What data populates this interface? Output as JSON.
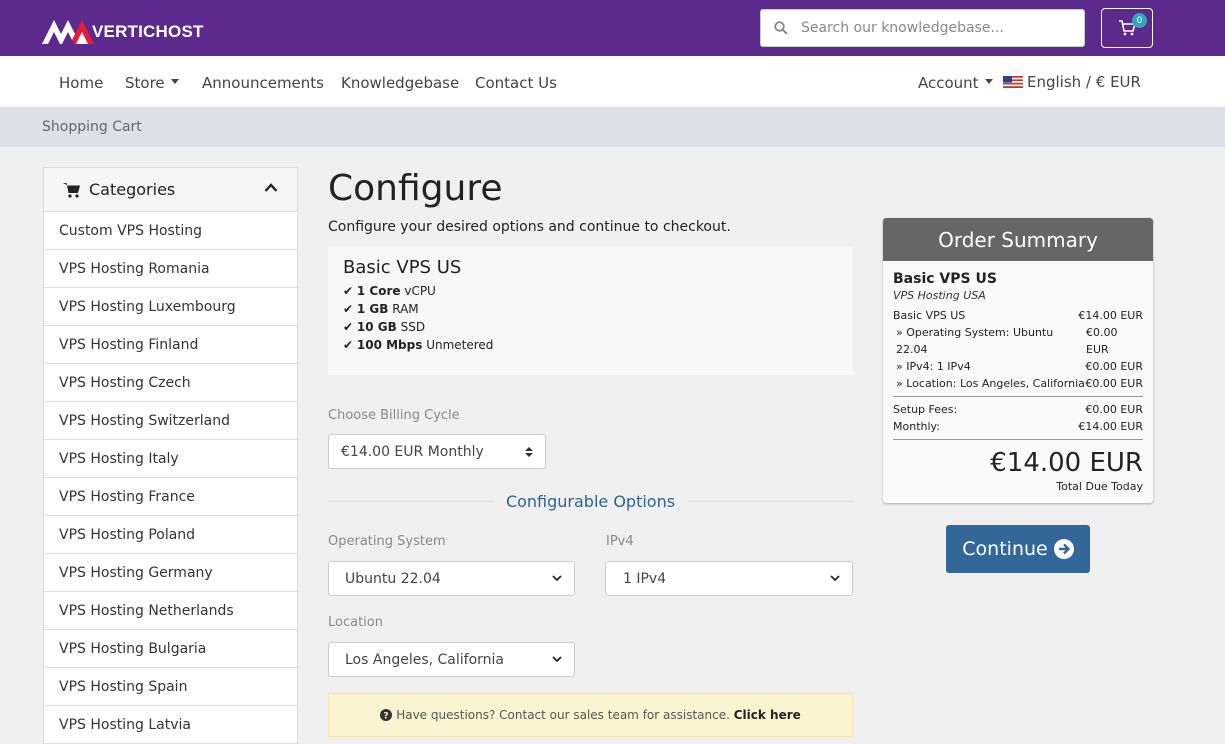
{
  "header": {
    "brand": "VERTICHOST",
    "search_placeholder": "Search our knowledgebase...",
    "cart_count": "0"
  },
  "nav": {
    "home": "Home",
    "store": "Store",
    "announcements": "Announcements",
    "knowledgebase": "Knowledgebase",
    "contact": "Contact Us",
    "account": "Account",
    "language": "English / € EUR"
  },
  "breadcrumb": "Shopping Cart",
  "sidebar": {
    "title": "Categories",
    "items": [
      "Custom VPS Hosting",
      "VPS Hosting Romania",
      "VPS Hosting Luxembourg",
      "VPS Hosting Finland",
      "VPS Hosting Czech",
      "VPS Hosting Switzerland",
      "VPS Hosting Italy",
      "VPS Hosting France",
      "VPS Hosting Poland",
      "VPS Hosting Germany",
      "VPS Hosting Netherlands",
      "VPS Hosting Bulgaria",
      "VPS Hosting Spain",
      "VPS Hosting Latvia"
    ]
  },
  "main": {
    "title": "Configure",
    "subtitle": "Configure your desired options and continue to checkout.",
    "product": {
      "name": "Basic VPS US",
      "features": [
        {
          "bold": "1 Core",
          "text": "vCPU"
        },
        {
          "bold": "1 GB",
          "text": "RAM"
        },
        {
          "bold": "10 GB",
          "text": "SSD"
        },
        {
          "bold": "100 Mbps",
          "text": "Unmetered"
        }
      ]
    },
    "billing_label": "Choose Billing Cycle",
    "billing_value": "€14.00 EUR Monthly",
    "configurable_title": "Configurable Options",
    "os_label": "Operating System",
    "os_value": "Ubuntu 22.04",
    "ipv4_label": "IPv4",
    "ipv4_value": "1 IPv4",
    "location_label": "Location",
    "location_value": "Los Angeles, California",
    "help_text": "Have questions? Contact our sales team for assistance.",
    "help_link": "Click here"
  },
  "summary": {
    "title": "Order Summary",
    "product_name": "Basic VPS US",
    "product_group": "VPS Hosting USA",
    "lines": [
      {
        "label": "Basic VPS US",
        "value": "€14.00 EUR"
      },
      {
        "label": "» Operating System: Ubuntu 22.04",
        "value": "€0.00 EUR"
      },
      {
        "label": "» IPv4: 1 IPv4",
        "value": "€0.00 EUR"
      },
      {
        "label": "» Location: Los Angeles, California",
        "value": "€0.00 EUR"
      }
    ],
    "setup_label": "Setup Fees:",
    "setup_value": "€0.00 EUR",
    "monthly_label": "Monthly:",
    "monthly_value": "€14.00 EUR",
    "total": "€14.00 EUR",
    "total_label": "Total Due Today"
  },
  "continue_label": "Continue",
  "colors": {
    "header_bg": "#5c2a8c",
    "continue_bg": "#336699",
    "badge_bg": "#31a6b8"
  }
}
